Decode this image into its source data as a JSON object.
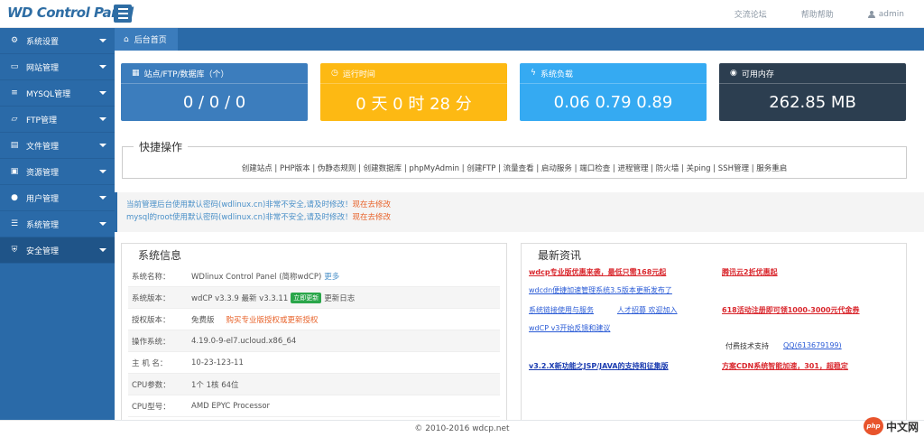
{
  "header": {
    "brand": "WD Control Panel",
    "links": [
      "交流论坛",
      "帮助帮助"
    ],
    "user": "admin"
  },
  "sidebar": {
    "items": [
      {
        "label": "系统设置",
        "icon": "gear-icon",
        "glyph": "⚙"
      },
      {
        "label": "网站管理",
        "icon": "monitor-icon",
        "glyph": "▭"
      },
      {
        "label": "MYSQL管理",
        "icon": "database-icon",
        "glyph": "≡"
      },
      {
        "label": "FTP管理",
        "icon": "folder-icon",
        "glyph": "▱"
      },
      {
        "label": "文件管理",
        "icon": "file-icon",
        "glyph": "▤"
      },
      {
        "label": "资源管理",
        "icon": "box-icon",
        "glyph": "▣"
      },
      {
        "label": "用户管理",
        "icon": "user-icon",
        "glyph": "●"
      },
      {
        "label": "系统管理",
        "icon": "list-icon",
        "glyph": "☰"
      },
      {
        "label": "安全管理",
        "icon": "shield-icon",
        "glyph": "⛨"
      }
    ]
  },
  "breadcrumb": "后台首页",
  "stats": [
    {
      "title": "站点/FTP/数据库（个）",
      "value": "0 / 0 / 0",
      "color": "#3c7dbd",
      "glyph": "▦"
    },
    {
      "title": "运行时间",
      "value": "0 天 0 时 28 分",
      "color": "#fdb913",
      "glyph": "◷"
    },
    {
      "title": "系统负载",
      "value": "0.06 0.79 0.89",
      "color": "#35aaf2",
      "glyph": "ϟ"
    },
    {
      "title": "可用内存",
      "value": "262.85 MB",
      "color": "#2c3e50",
      "glyph": "◉"
    }
  ],
  "quick": {
    "title": "快捷操作",
    "links": "创建站点 | PHP版本 | 伪静态规则 | 创建数据库 | phpMyAdmin | 创建FTP | 流量查看 | 启动服务 | 端口检查 | 进程管理 | 防火墙 | 关ping | SSH管理 | 服务重启"
  },
  "notice": {
    "line1": "当前管理后台使用默认密码(wdlinux.cn)非常不安全,请及时修改！",
    "line1_link": "现在去修改",
    "line2": "mysql的root使用默认密码(wdlinux.cn)非常不安全,请及时修改！",
    "line2_link": "现在去修改"
  },
  "sysinfo": {
    "title": "系统信息",
    "rows": [
      {
        "label": "系统名称：",
        "value": "WDlinux Control Panel (简称wdCP)",
        "extra": "更多"
      },
      {
        "label": "系统版本：",
        "value": "wdCP v3.3.9 最新 v3.3.11",
        "badge": "立即更新",
        "extra": "更新日志"
      },
      {
        "label": "授权版本：",
        "value": "免费版",
        "extra": "购买专业版授权或更新授权"
      },
      {
        "label": "操作系统：",
        "value": "4.19.0-9-el7.ucloud.x86_64"
      },
      {
        "label": "主 机 名：",
        "value": "10-23-123-11"
      },
      {
        "label": "CPU参数：",
        "value": "1个 1核 64位"
      },
      {
        "label": "CPU型号：",
        "value": "AMD EPYC Processor"
      }
    ]
  },
  "news": {
    "title": "最新资讯",
    "items": [
      "wdcp专业版优惠来袭，最低只需168元起",
      "腾讯云2折优惠起",
      "wdcdn便捷加速管理系统3.5版本更新发布了",
      "系统链接使用与服务",
      "人才招募 欢迎加入",
      "618活动注册即可领1000-3000元代金券",
      "wdCP v3开始反馈和建议",
      "付费技术支持",
      "QQ(613679199)",
      "v3.2.X新功能之JSP/JAVA的支持和征集版",
      "方案CDN系统智能加速，301，超稳定"
    ]
  },
  "footer": "© 2010-2016 wdcp.net",
  "watermark": "php 中文网"
}
